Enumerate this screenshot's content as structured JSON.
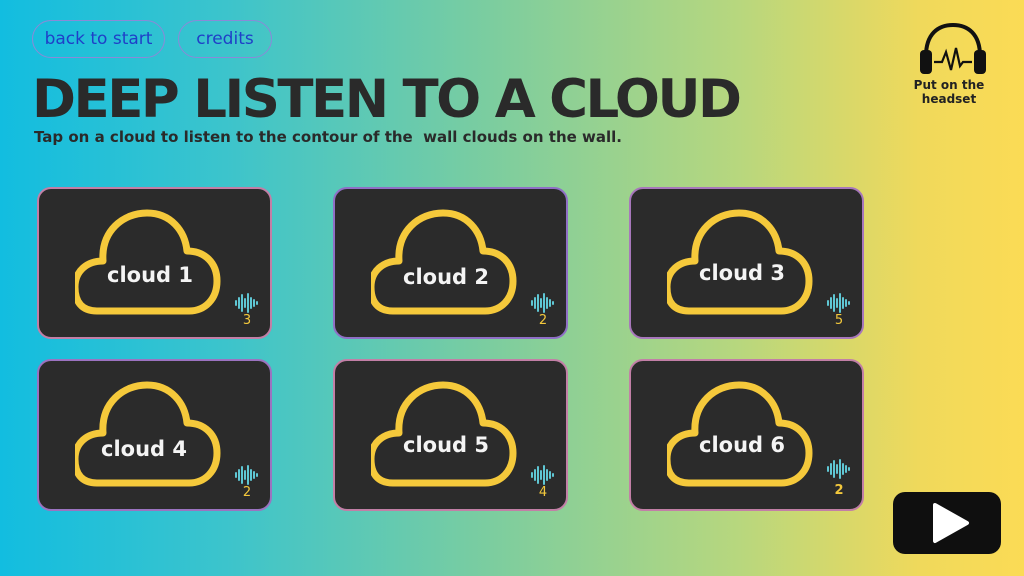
{
  "nav": {
    "back_label": "back to start",
    "credits_label": "credits"
  },
  "page": {
    "title": "DEEP LISTEN TO A CLOUD",
    "subtitle": "Tap on a cloud to listen to the contour of the  wall clouds on the wall."
  },
  "headset": {
    "label": "Put on the headset",
    "icon": "headphones-icon"
  },
  "clouds": [
    {
      "label": "cloud 1",
      "count": "3"
    },
    {
      "label": "cloud 2",
      "count": "2"
    },
    {
      "label": "cloud 3",
      "count": "5"
    },
    {
      "label": "cloud 4",
      "count": "2"
    },
    {
      "label": "cloud 5",
      "count": "4"
    },
    {
      "label": "cloud 6",
      "count": "2"
    }
  ],
  "colors": {
    "card_bg": "#2b2b2b",
    "cloud_outline": "#f5c93b",
    "wave_icon": "#5fc7d4",
    "title_text": "#2a2a2a"
  },
  "play_button": {
    "icon": "play-icon"
  }
}
